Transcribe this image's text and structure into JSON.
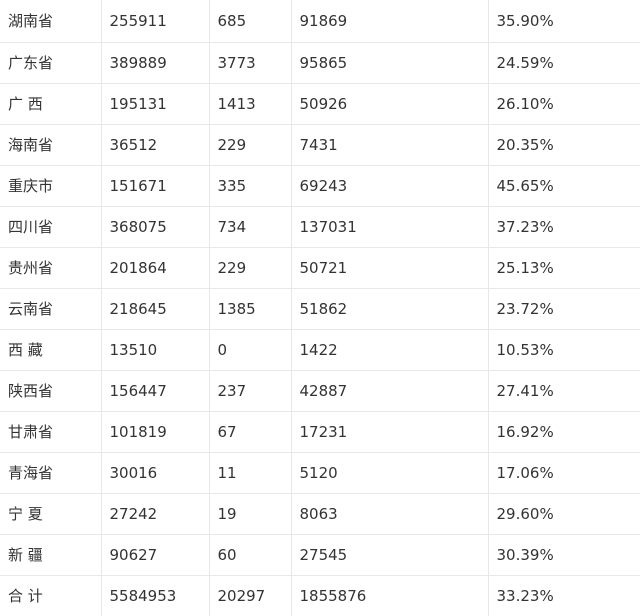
{
  "table": {
    "rows": [
      {
        "region": "湖南省",
        "c2": "255911",
        "c3": "685",
        "c4": "91869",
        "c5": "35.90%"
      },
      {
        "region": "广东省",
        "c2": "389889",
        "c3": "3773",
        "c4": "95865",
        "c5": "24.59%"
      },
      {
        "region": "广 西",
        "c2": "195131",
        "c3": "1413",
        "c4": "50926",
        "c5": "26.10%"
      },
      {
        "region": "海南省",
        "c2": "36512",
        "c3": "229",
        "c4": "7431",
        "c5": "20.35%"
      },
      {
        "region": "重庆市",
        "c2": "151671",
        "c3": "335",
        "c4": "69243",
        "c5": "45.65%"
      },
      {
        "region": "四川省",
        "c2": "368075",
        "c3": "734",
        "c4": "137031",
        "c5": "37.23%"
      },
      {
        "region": "贵州省",
        "c2": "201864",
        "c3": "229",
        "c4": "50721",
        "c5": "25.13%"
      },
      {
        "region": "云南省",
        "c2": "218645",
        "c3": "1385",
        "c4": "51862",
        "c5": "23.72%"
      },
      {
        "region": "西 藏",
        "c2": "13510",
        "c3": "0",
        "c4": "1422",
        "c5": "10.53%"
      },
      {
        "region": "陕西省",
        "c2": "156447",
        "c3": "237",
        "c4": "42887",
        "c5": "27.41%"
      },
      {
        "region": "甘肃省",
        "c2": "101819",
        "c3": "67",
        "c4": "17231",
        "c5": "16.92%"
      },
      {
        "region": "青海省",
        "c2": "30016",
        "c3": "11",
        "c4": "5120",
        "c5": "17.06%"
      },
      {
        "region": "宁 夏",
        "c2": "27242",
        "c3": "19",
        "c4": "8063",
        "c5": "29.60%"
      },
      {
        "region": "新 疆",
        "c2": "90627",
        "c3": "60",
        "c4": "27545",
        "c5": "30.39%"
      }
    ],
    "total": {
      "region": "合 计",
      "c2": "5584953",
      "c3": "20297",
      "c4": "1855876",
      "c5": "33.23%"
    }
  }
}
